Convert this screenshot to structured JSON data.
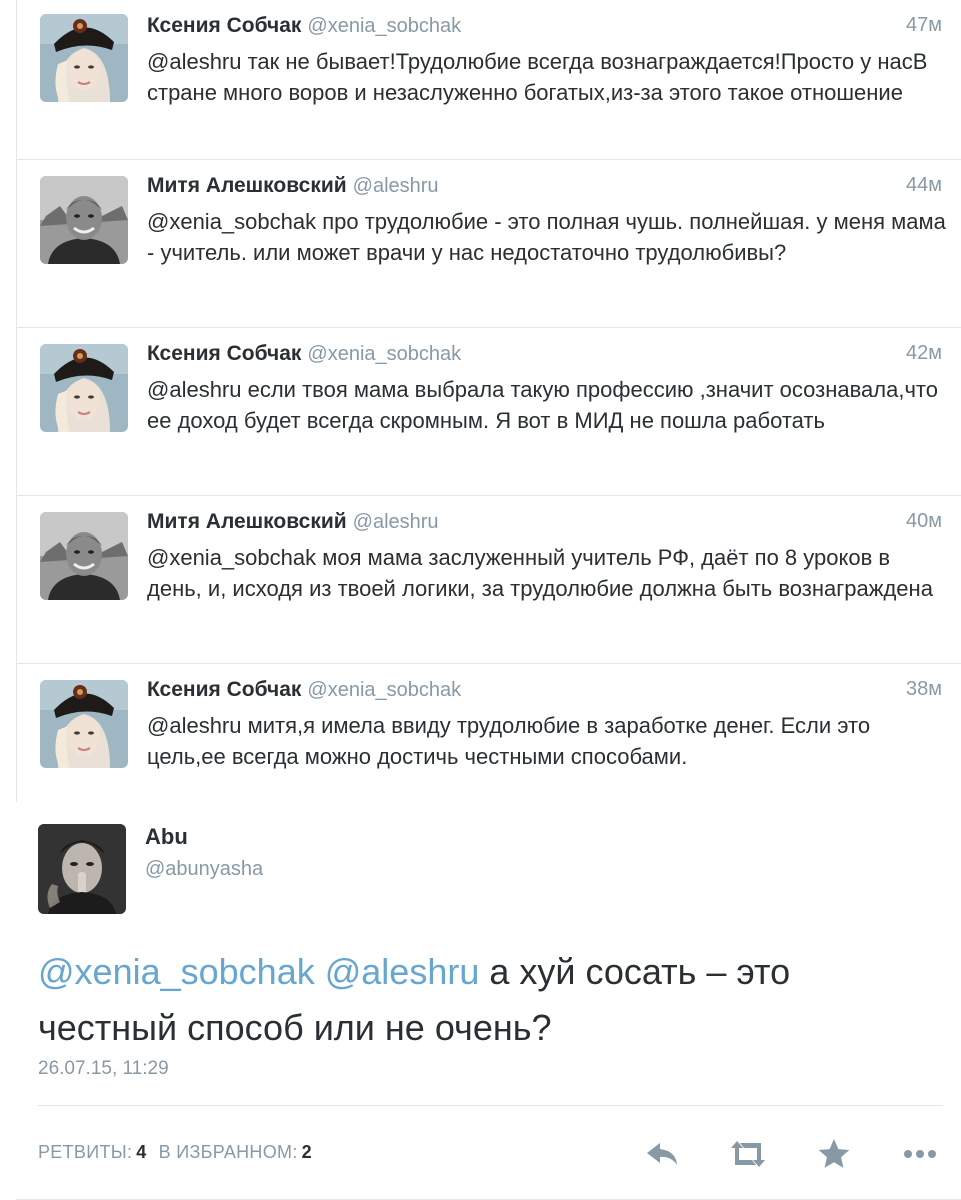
{
  "timeline": {
    "tweets": [
      {
        "name": "Ксения Собчак",
        "handle": "@xenia_sobchak",
        "time": "47м",
        "text": "@aleshru так не бывает!Трудолюбие всегда вознаграждается!Просто у насВ стране много воров и незаслуженно богатых,из-за этого такое отношение"
      },
      {
        "name": "Митя Алешковский",
        "handle": "@aleshru",
        "time": "44м",
        "text": "@xenia_sobchak про трудолюбие - это полная чушь. полнейшая. у меня мама - учитель. или может врачи у нас недостаточно трудолюбивы?"
      },
      {
        "name": "Ксения Собчак",
        "handle": "@xenia_sobchak",
        "time": "42м",
        "text": "@aleshru если твоя мама выбрала такую профессию ,значит осознавала,что ее доход будет всегда скромным. Я вот в МИД не пошла работать"
      },
      {
        "name": "Митя Алешковский",
        "handle": "@aleshru",
        "time": "40м",
        "text": "@xenia_sobchak моя мама заслуженный учитель РФ, даёт по 8 уроков в день, и, исходя из твоей логики, за трудолюбие должна быть вознаграждена"
      },
      {
        "name": "Ксения Собчак",
        "handle": "@xenia_sobchak",
        "time": "38м",
        "text": "@aleshru митя,я имела ввиду трудолюбие в заработке денег. Если это цель,ее всегда можно достичь честными способами."
      }
    ]
  },
  "detail": {
    "name": "Abu",
    "handle": "@abunyasha",
    "mention1": "@xenia_sobchak",
    "mention2": "@aleshru",
    "text_rest": " а хуй сосать – это честный способ или не очень?",
    "date": "26.07.15, 11:29",
    "retweets_label": "РЕТВИТЫ:",
    "retweets_count": "4",
    "favorites_label": "В ИЗБРАННОМ:",
    "favorites_count": "2"
  },
  "icons": {
    "reply": "reply-icon",
    "retweet": "retweet-icon",
    "favorite": "star-icon",
    "more": "more-icon"
  },
  "colors": {
    "text": "#292f33",
    "secondary": "#8899a6",
    "mention": "#66a6cf",
    "border": "#e1e8ed",
    "action_icon": "#8899a6"
  }
}
